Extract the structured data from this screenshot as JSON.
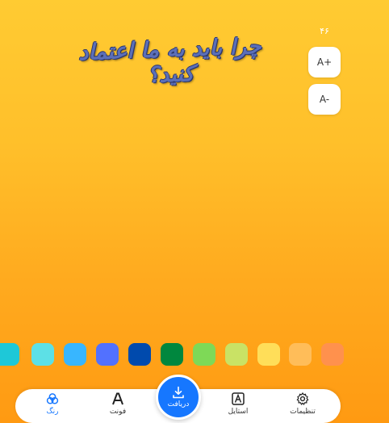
{
  "canvas": {
    "headline": "چرا باید به ما اعتماد کنید؟",
    "font_size_value": "۴۶"
  },
  "size_controls": {
    "increase_label": "A+",
    "decrease_label": "A-"
  },
  "palette": {
    "colors": [
      "#1ec8d8",
      "#5de0e6",
      "#38b6ff",
      "#5271ff",
      "#004aad",
      "#00873e",
      "#7ed957",
      "#c9e265",
      "#ffde59",
      "#ffbd59",
      "#ff914d"
    ]
  },
  "bottom_nav": {
    "color_label": "رنگ",
    "font_label": "فونت",
    "download_label": "دریافت",
    "style_label": "استایل",
    "settings_label": "تنظیمات",
    "active_color": "#1677ff"
  }
}
